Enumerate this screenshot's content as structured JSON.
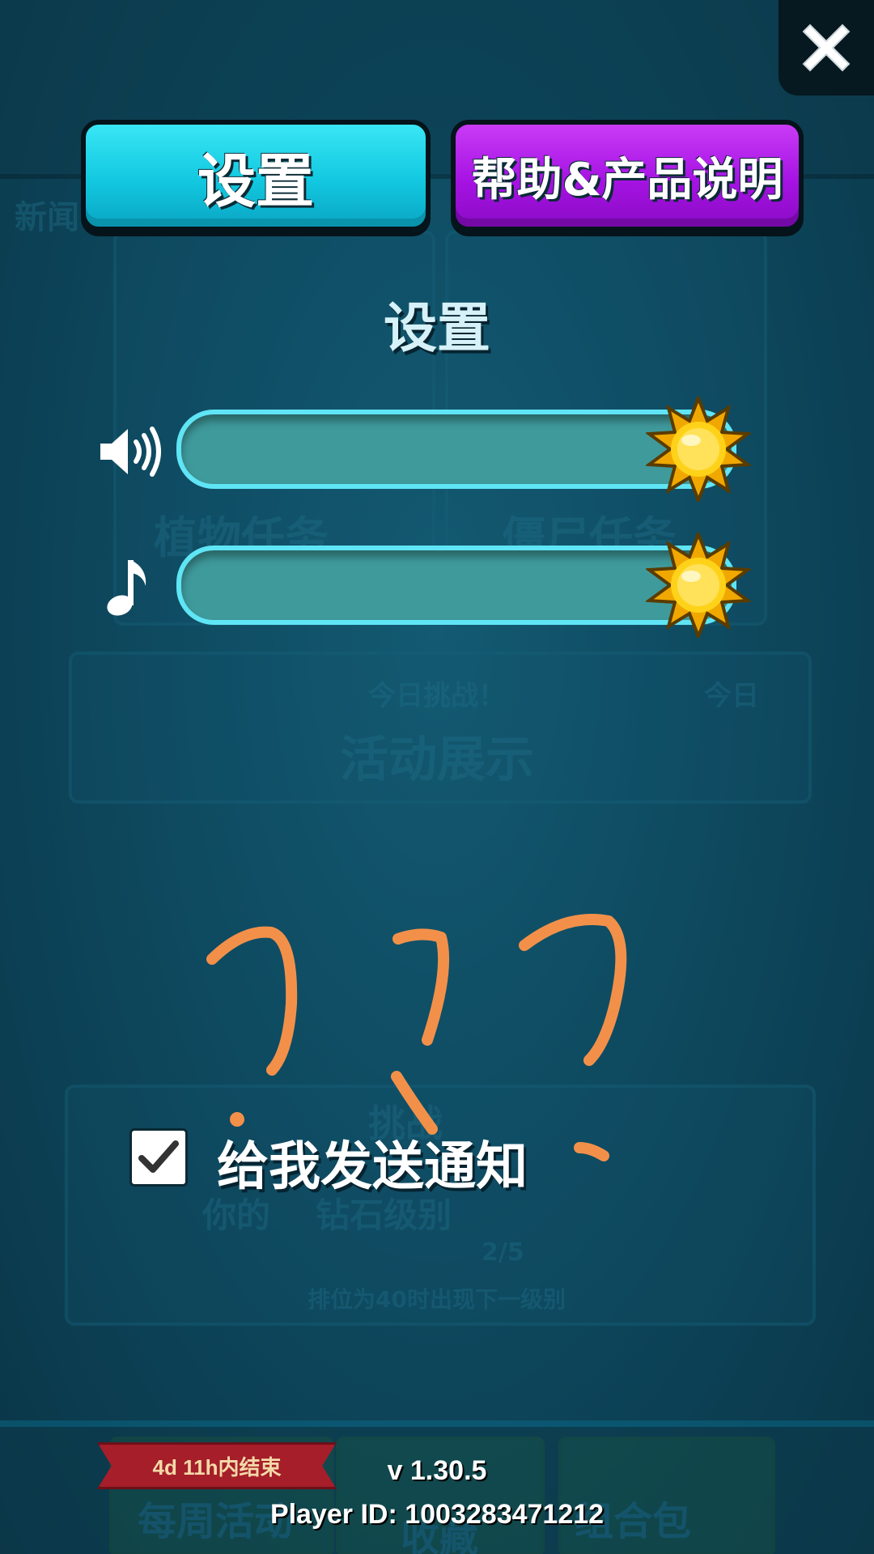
{
  "tabs": {
    "settings_label": "设置",
    "help_label": "帮助&产品说明",
    "active": "settings"
  },
  "panel": {
    "title": "设置"
  },
  "sliders": [
    {
      "name": "sound",
      "icon": "speaker-icon",
      "level": 1.0
    },
    {
      "name": "music",
      "icon": "music-note-icon",
      "level": 1.0
    }
  ],
  "notifications": {
    "label": "给我发送通知",
    "checked": true
  },
  "footer": {
    "version": "v 1.30.5",
    "player_id": "Player ID: 1003283471212"
  },
  "background": {
    "texts": [
      "新闻",
      "植物任务",
      "僵尸任务",
      "今日挑战！",
      "今日",
      "活动展示",
      "挑战",
      "你的",
      "钻石级别",
      "2/5",
      "排位为40时出现下一级别",
      "每周活动",
      "收藏",
      "组合包"
    ],
    "ribbon": "4d 11h内结束"
  },
  "annotation": {
    "drawn_text": "777",
    "color": "#f2904a"
  },
  "colors": {
    "settings_tab": "#12c8e0",
    "help_tab": "#a613e3",
    "slider_track": "#3f9a9c",
    "slider_border": "#5fe5f5",
    "sun_knob": "#f5c400"
  }
}
